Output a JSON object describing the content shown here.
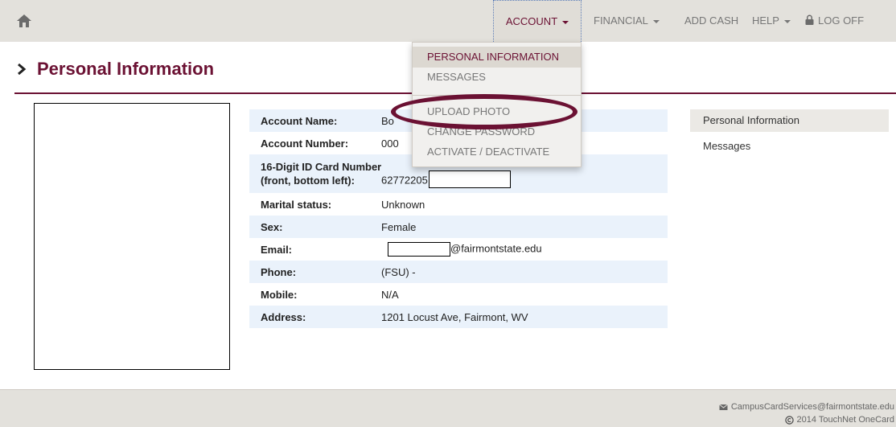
{
  "nav": {
    "account": "ACCOUNT",
    "financial": "FINANCIAL",
    "add_cash": "ADD CASH",
    "help": "HELP",
    "log_off": "LOG OFF"
  },
  "icons": {
    "home": "home-icon",
    "lock": "lock-icon",
    "chevron": "chevron-right-icon",
    "envelope": "envelope-icon",
    "copyright": "copyright-icon"
  },
  "colors": {
    "brand": "#6b1133",
    "navbar_bg": "#e3e1dc",
    "row_shade": "#eaf2fb"
  },
  "dropdown": {
    "items": [
      {
        "label": "PERSONAL INFORMATION"
      },
      {
        "label": "MESSAGES"
      },
      {
        "label": "UPLOAD PHOTO"
      },
      {
        "label": "CHANGE PASSWORD"
      },
      {
        "label": "ACTIVATE / DEACTIVATE"
      }
    ]
  },
  "page": {
    "title": "Personal Information"
  },
  "info": {
    "rows": [
      {
        "label": "Account Name:",
        "value": "Bo"
      },
      {
        "label": "Account Number:",
        "value": "000"
      },
      {
        "label": "16-Digit ID Card Number",
        "label2": "(front, bottom left):",
        "value": "62772205"
      },
      {
        "label": "Marital status:",
        "value": "Unknown"
      },
      {
        "label": "Sex:",
        "value": "Female"
      },
      {
        "label": "Email:",
        "value": "@fairmontstate.edu"
      },
      {
        "label": "Phone:",
        "value": "(FSU) -"
      },
      {
        "label": "Mobile:",
        "value": "N/A"
      },
      {
        "label": "Address:",
        "value": "1201 Locust Ave, Fairmont, WV"
      }
    ]
  },
  "side": {
    "links": [
      {
        "label": "Personal Information"
      },
      {
        "label": "Messages"
      }
    ]
  },
  "footer": {
    "email": "CampusCardServices@fairmontstate.edu",
    "copyright": "2014 TouchNet OneCard"
  }
}
